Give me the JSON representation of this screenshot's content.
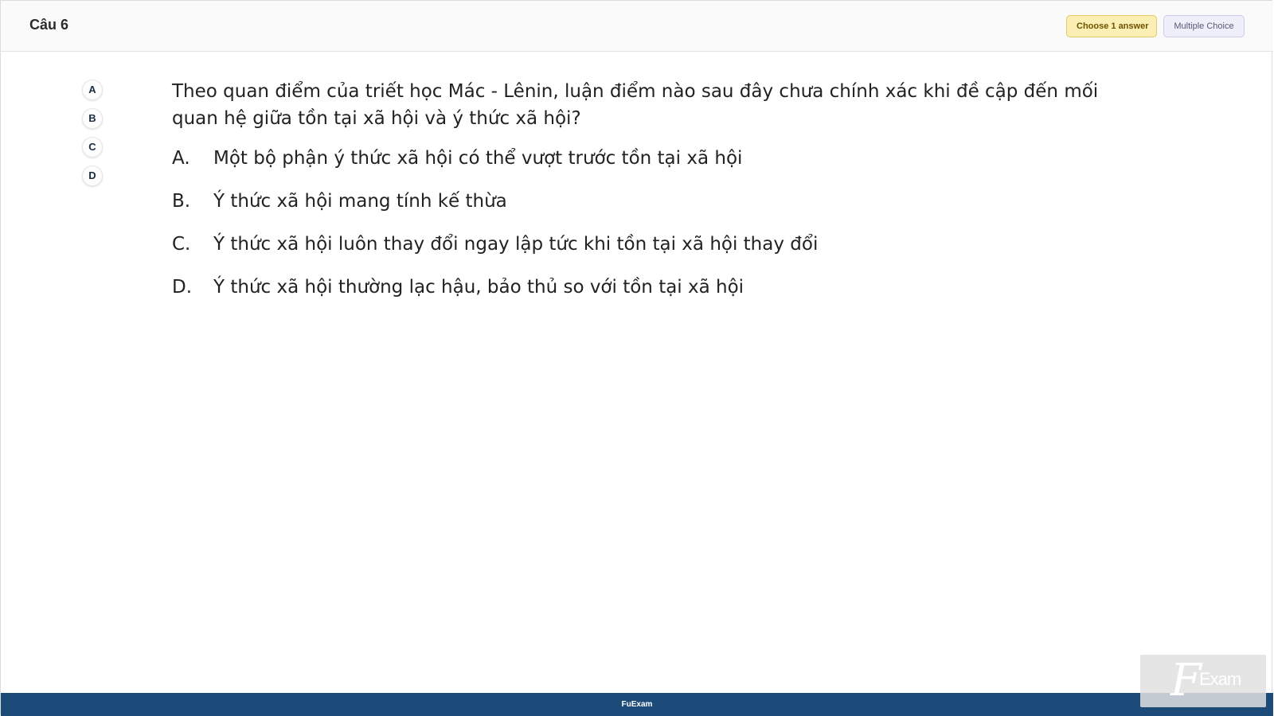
{
  "header": {
    "question_title": "Câu 6",
    "badge_choose": "Choose 1 answer",
    "badge_type": "Multiple Choice"
  },
  "picker": [
    "A",
    "B",
    "C",
    "D"
  ],
  "question": {
    "text": "Theo quan điểm của triết học Mác - Lênin, luận điểm nào sau đây chưa chính xác khi đề cập đến mối quan hệ giữa tồn tại xã hội và ý thức xã hội?"
  },
  "answers": [
    {
      "letter": "A.",
      "text": "Một bộ phận ý thức xã hội có thể vượt trước tồn tại xã hội"
    },
    {
      "letter": "B.",
      "text": "Ý thức xã hội mang tính kế thừa"
    },
    {
      "letter": "C.",
      "text": "Ý thức xã hội luôn thay đổi ngay lập tức khi tồn tại xã hội thay đổi"
    },
    {
      "letter": "D.",
      "text": "Ý thức xã hội thường lạc hậu, bảo thủ so với tồn tại xã hội"
    }
  ],
  "footer": {
    "brand": "FuExam"
  },
  "watermark": {
    "f": "F",
    "exam": "Exam"
  },
  "colors": {
    "footer_bg": "#1c4a79",
    "badge_choose_bg": "#fcefb4",
    "badge_type_bg": "#efeefb"
  }
}
